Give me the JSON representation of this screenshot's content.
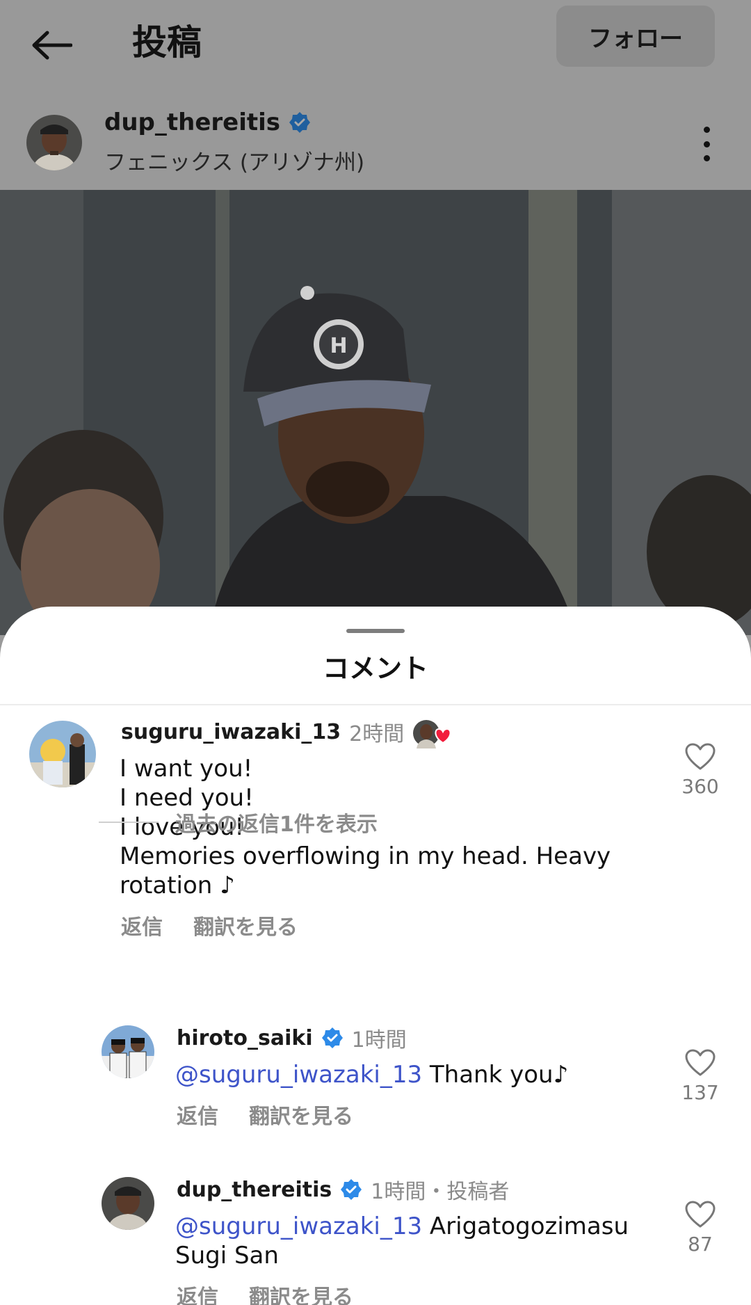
{
  "header": {
    "title": "投稿",
    "follow_label": "フォロー"
  },
  "post": {
    "username": "dup_thereitis",
    "location": "フェニックス (アリゾナ州)"
  },
  "sheet": {
    "title": "コメント"
  },
  "comments": [
    {
      "username": "suguru_iwazaki_13",
      "time": "2時間",
      "lines": [
        "I want you!",
        "I need you!",
        "I love you!",
        "Memories overflowing in my head. Heavy",
        "rotation ♪"
      ],
      "reply_label": "返信",
      "translate_label": "翻訳を見る",
      "likes": "360"
    }
  ],
  "view_replies": "過去の返信1件を表示",
  "replies": [
    {
      "username": "hiroto_saiki",
      "time": "1時間",
      "mention": "@suguru_iwazaki_13",
      "text": " Thank you♪",
      "reply_label": "返信",
      "translate_label": "翻訳を見る",
      "likes": "137"
    },
    {
      "username": "dup_thereitis",
      "time": "1時間・投稿者",
      "mention": "@suguru_iwazaki_13",
      "text": " Arigatogozimasu",
      "text2": "Sugi San",
      "reply_label": "返信",
      "translate_label": "翻訳を見る",
      "likes": "87"
    }
  ],
  "colors": {
    "mention": "#3e54c9",
    "verified": "#2d8ae8",
    "heart": "#f21d3c"
  }
}
